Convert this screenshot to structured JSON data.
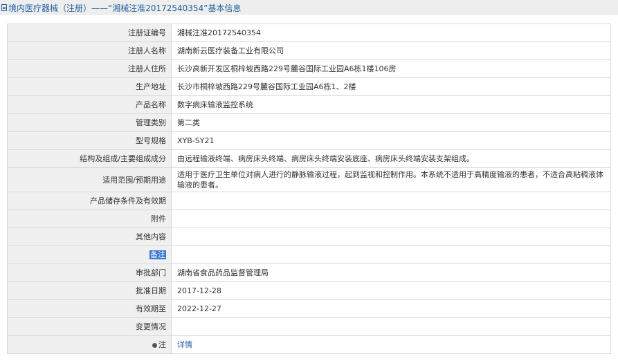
{
  "header": {
    "icon": "document-icon",
    "title": "境内医疗器械（注册）——“湘械注准20172540354”基本信息",
    "accent": "#1f5e9e"
  },
  "rows": [
    {
      "label": "注册证编号",
      "value": "湘械注准20172540354"
    },
    {
      "label": "注册人名称",
      "value": "湖南新云医疗装备工业有限公司"
    },
    {
      "label": "注册人住所",
      "value": "长沙高新开发区桐梓坡西路229号麓谷国际工业园A6栋1楼106房"
    },
    {
      "label": "生产地址",
      "value": "长沙市桐梓坡西路229号麓谷国际工业园A6栋1、2楼"
    },
    {
      "label": "产品名称",
      "value": "数字病床输液监控系统"
    },
    {
      "label": "管理类别",
      "value": "第二类"
    },
    {
      "label": "型号规格",
      "value": "XYB-SY21"
    },
    {
      "label": "结构及组成/主要组成成分",
      "value": "由远程输液终端、病房床头终端、病房床头终端安装底座、病房床头终端安装支架组成。"
    },
    {
      "label": "适用范围/预期用途",
      "value": "适用于医疗卫生单位对病人进行的静脉输液过程，起到监视和控制作用。本系统不适用于高精度输液的患者，不适合高粘稠液体输液的患者。"
    },
    {
      "label": "产品储存条件及有效期",
      "value": ""
    },
    {
      "label": "附件",
      "value": ""
    },
    {
      "label": "其他内容",
      "value": ""
    },
    {
      "label": "备注",
      "value": ""
    },
    {
      "label": "审批部门",
      "value": "湖南省食品药品监督管理局"
    },
    {
      "label": "批准日期",
      "value": "2017-12-28"
    },
    {
      "label": "有效期至",
      "value": "2022-12-27"
    },
    {
      "label": "变更情况",
      "value": ""
    }
  ],
  "note": {
    "icon": "pin-icon",
    "label": "注",
    "link_text": "详情"
  }
}
